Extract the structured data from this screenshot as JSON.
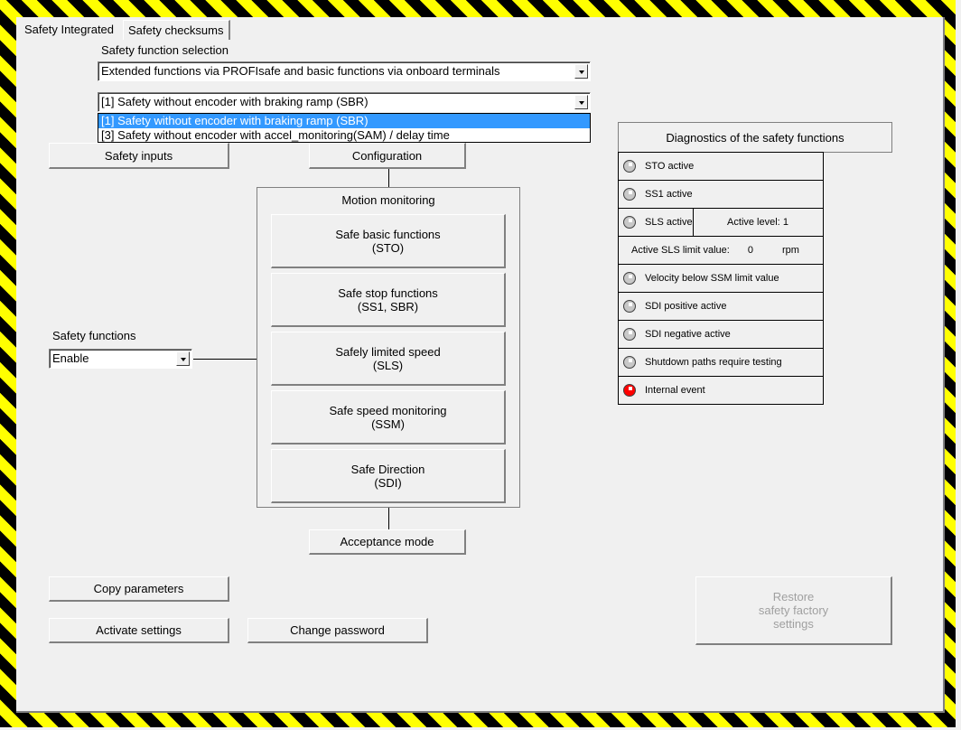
{
  "tabs": [
    {
      "label": "Safety Integrated",
      "active": true
    },
    {
      "label": "Safety checksums",
      "active": false
    }
  ],
  "selection": {
    "label": "Safety function selection",
    "mode_value": "Extended functions via PROFIsafe and basic functions via onboard terminals",
    "variant_value": "[1] Safety without encoder with braking ramp (SBR)",
    "variant_options": [
      "[1] Safety without encoder with braking ramp (SBR)",
      "[3] Safety without encoder with accel_monitoring(SAM) / delay time"
    ],
    "selected_option_index": 0
  },
  "buttons": {
    "safety_inputs": "Safety inputs",
    "configuration": "Configuration",
    "acceptance_mode": "Acceptance mode",
    "copy_parameters": "Copy parameters",
    "activate_settings": "Activate settings",
    "change_password": "Change password",
    "restore_line1": "Restore",
    "restore_line2": "safety factory",
    "restore_line3": "settings"
  },
  "safety_functions": {
    "label": "Safety functions",
    "value": "Enable"
  },
  "motion_monitoring": {
    "title": "Motion monitoring",
    "items": [
      {
        "line1": "Safe basic functions",
        "line2": "(STO)"
      },
      {
        "line1": "Safe stop functions",
        "line2": "(SS1, SBR)"
      },
      {
        "line1": "Safely limited speed",
        "line2": "(SLS)"
      },
      {
        "line1": "Safe speed monitoring",
        "line2": "(SSM)"
      },
      {
        "line1": "Safe Direction",
        "line2": "(SDI)"
      }
    ]
  },
  "diagnostics": {
    "title": "Diagnostics of the safety functions",
    "sto": {
      "label": "STO active",
      "state": "off"
    },
    "ss1": {
      "label": "SS1 active",
      "state": "off"
    },
    "sls": {
      "label": "SLS active",
      "state": "off"
    },
    "active_level_label": "Active level:",
    "active_level_value": "1",
    "sls_limit_label": "Active SLS limit value:",
    "sls_limit_value": "0",
    "sls_limit_unit": "rpm",
    "ssm": {
      "label": "Velocity below SSM limit value",
      "state": "off"
    },
    "sdi_pos": {
      "label": "SDI positive active",
      "state": "off"
    },
    "sdi_neg": {
      "label": "SDI negative active",
      "state": "off"
    },
    "shutdown": {
      "label": "Shutdown paths require testing",
      "state": "off"
    },
    "internal": {
      "label": "Internal event",
      "state": "on",
      "color": "#ff0000"
    }
  }
}
